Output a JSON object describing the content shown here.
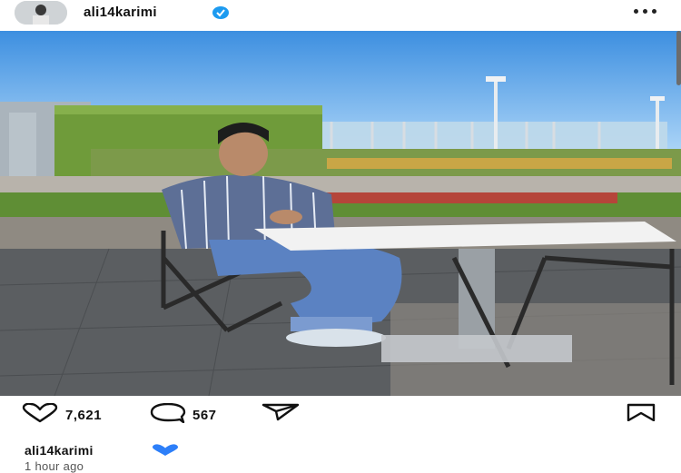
{
  "post": {
    "username": "ali14karimi",
    "likes": "7,621",
    "comments": "567",
    "caption_username": "ali14karimi",
    "timestamp": "1 hour ago"
  },
  "icons": {
    "verified": "verified-badge-icon",
    "more": "more-options-icon",
    "like": "heart-icon",
    "comment": "comment-icon",
    "share": "send-icon",
    "save": "bookmark-icon",
    "caption_emoji": "blue-heart-emoji"
  },
  "colors": {
    "verified_blue": "#1d9bf0",
    "emoji_blue": "#2d7ff9"
  }
}
